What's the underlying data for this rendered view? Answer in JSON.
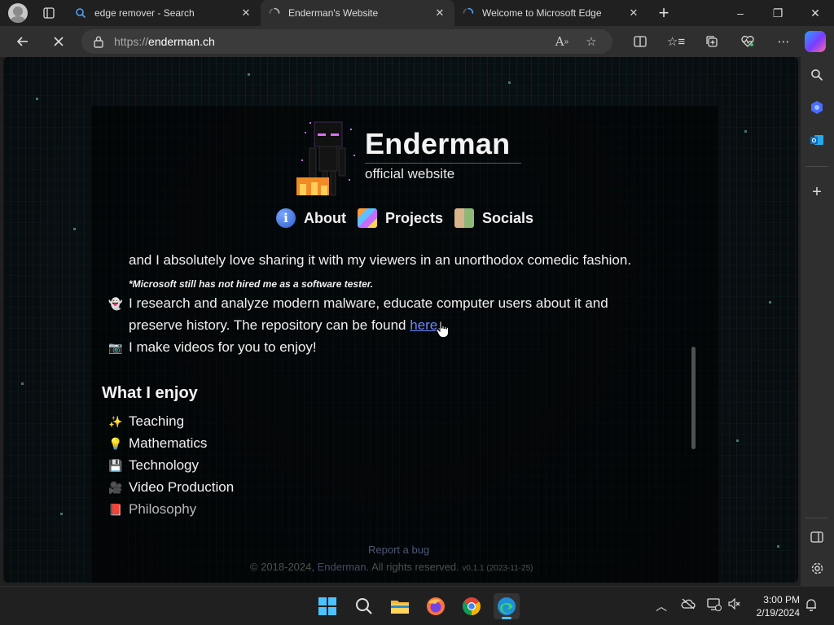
{
  "browser": {
    "tabs": [
      {
        "title": "edge remover - Search",
        "icon": "search-icon",
        "active": false
      },
      {
        "title": "Enderman's Website",
        "icon": "loading-spinner-icon",
        "active": true
      },
      {
        "title": "Welcome to Microsoft Edge",
        "icon": "loading-spinner-icon",
        "active": false
      }
    ],
    "url_prefix": "https://",
    "url_host": "enderman.ch",
    "window_controls": {
      "minimize": "–",
      "restore": "❐",
      "close": "✕"
    }
  },
  "site": {
    "title": "Enderman",
    "subtitle": "official website",
    "nav": [
      {
        "label": "About",
        "icon": "info-icon"
      },
      {
        "label": "Projects",
        "icon": "projects-icon"
      },
      {
        "label": "Socials",
        "icon": "socials-icon"
      }
    ],
    "intro_line": "and I absolutely love sharing it with my viewers in an unorthodox comedic fashion.",
    "note": "*Microsoft still has not hired me as a software tester.",
    "malware_line_1": "I research and analyze modern malware, educate computer users about it and",
    "malware_line_2_prefix": "preserve history. The repository can be found ",
    "malware_link": "here",
    "malware_line_2_suffix": ".",
    "videos_line": "I make videos for you to enjoy!",
    "enjoy_heading": "What I enjoy",
    "enjoy_items": [
      {
        "emoji": "✨",
        "label": "Teaching"
      },
      {
        "emoji": "💡",
        "label": "Mathematics"
      },
      {
        "emoji": "💾",
        "label": "Technology"
      },
      {
        "emoji": "🎥",
        "label": "Video Production"
      },
      {
        "emoji": "📕",
        "label": "Philosophy"
      }
    ],
    "footer_bug": "Report a bug",
    "footer_copyright_prefix": "© 2018-2024,",
    "footer_copyright_name": "Enderman",
    "footer_copyright_suffix": ". All rights reserved.",
    "footer_version": "v0.1.1 (2023-11-25)"
  },
  "taskbar": {
    "time": "3:00 PM",
    "date": "2/19/2024"
  }
}
